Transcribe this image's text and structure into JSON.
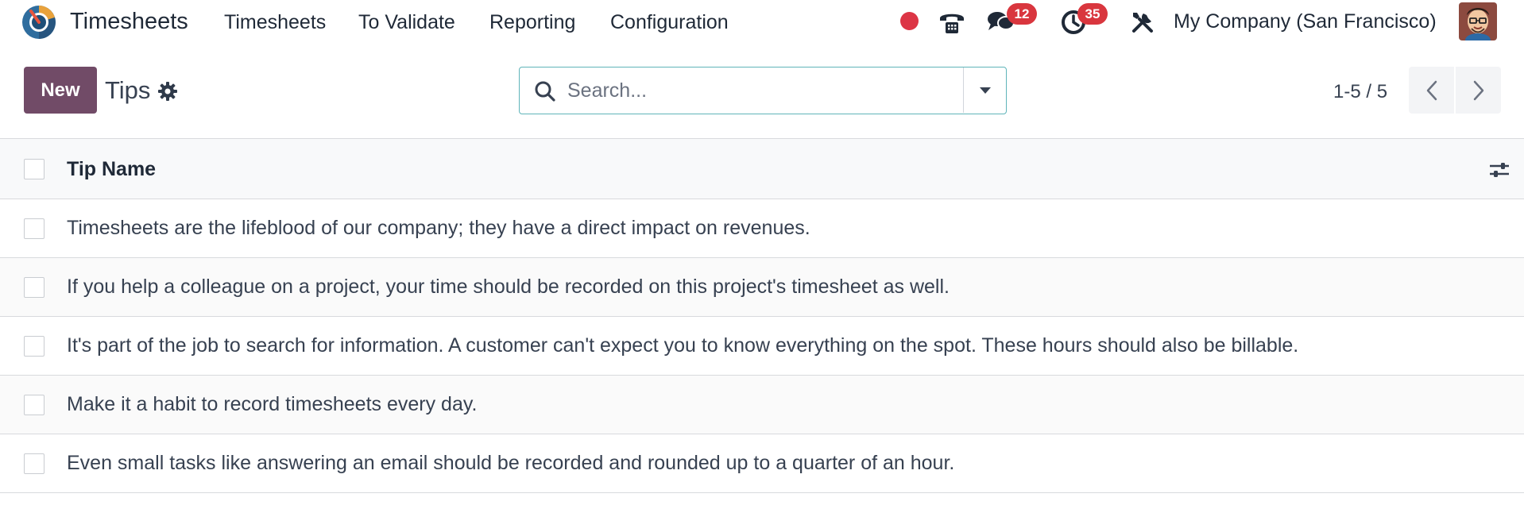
{
  "navbar": {
    "app_title": "Timesheets",
    "menu": [
      {
        "label": "Timesheets"
      },
      {
        "label": "To Validate"
      },
      {
        "label": "Reporting"
      },
      {
        "label": "Configuration"
      }
    ],
    "messages_count": "12",
    "activities_count": "35",
    "company": "My Company (San Francisco)",
    "icons": [
      "recording-dot-icon",
      "phone-icon",
      "chat-icon",
      "clock-icon",
      "tools-icon"
    ]
  },
  "control_panel": {
    "new_label": "New",
    "title": "Tips",
    "search_placeholder": "Search...",
    "pager": "1-5 / 5"
  },
  "list": {
    "column": "Tip Name",
    "rows": [
      {
        "name": "Timesheets are the lifeblood of our company; they have a direct impact on revenues."
      },
      {
        "name": "If you help a colleague on a project, your time should be recorded on this project's timesheet as well."
      },
      {
        "name": "It's part of the job to search for information. A customer can't expect you to know everything on the spot. These hours should also be billable."
      },
      {
        "name": "Make it a habit to record timesheets every day."
      },
      {
        "name": "Even small tasks like answering an email should be recorded and rounded up to a quarter of an hour."
      }
    ]
  },
  "colors": {
    "brand": "#714b67",
    "badge": "#d9363e",
    "search_border": "#5fb4b9"
  }
}
